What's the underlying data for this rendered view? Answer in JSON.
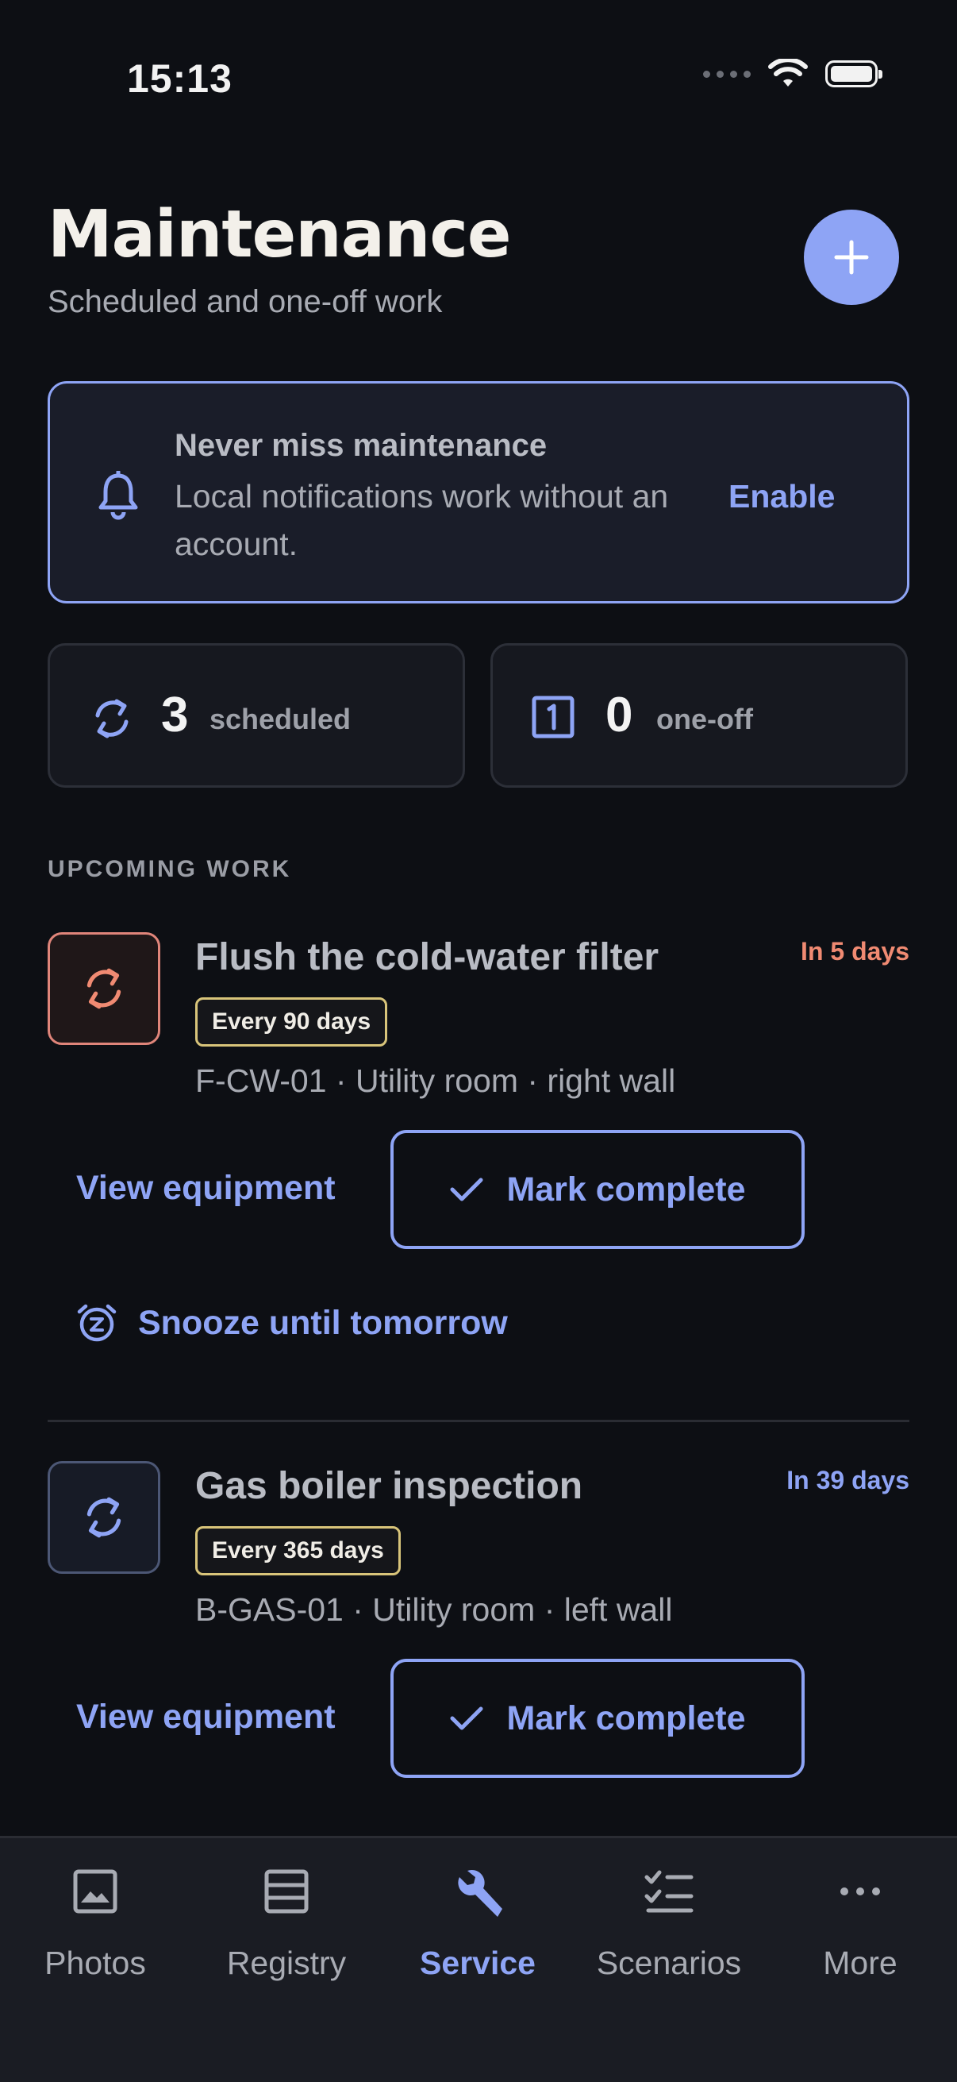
{
  "status_bar": {
    "time": "15:13"
  },
  "header": {
    "title": "Maintenance",
    "subtitle": "Scheduled and one-off work",
    "add_icon": "plus-icon"
  },
  "banner": {
    "title": "Never miss maintenance",
    "body": "Local notifications work without an account.",
    "action": "Enable",
    "icon": "bell-icon"
  },
  "stats": {
    "scheduled": {
      "count": "3",
      "label": "scheduled",
      "icon": "repeat-icon"
    },
    "one_off": {
      "count": "0",
      "label": "one-off",
      "icon": "one-box-icon"
    }
  },
  "section_label": "UPCOMING WORK",
  "tasks": [
    {
      "title": "Flush the cold-water filter",
      "due": "In 5 days",
      "due_color": "#f08a72",
      "frequency": "Every 90 days",
      "location": "F-CW-01 · Utility room · right wall",
      "view_label": "View equipment",
      "complete_label": "Mark complete",
      "snooze_label": "Snooze until tomorrow"
    },
    {
      "title": "Gas boiler inspection",
      "due": "In 39 days",
      "due_color": "#8ea4f5",
      "frequency": "Every 365 days",
      "location": "B-GAS-01 · Utility room · left wall",
      "view_label": "View equipment",
      "complete_label": "Mark complete"
    }
  ],
  "nav": {
    "items": [
      {
        "label": "Photos",
        "icon": "image-icon"
      },
      {
        "label": "Registry",
        "icon": "list-box-icon"
      },
      {
        "label": "Service",
        "icon": "wrench-icon",
        "active": true
      },
      {
        "label": "Scenarios",
        "icon": "checklist-icon"
      },
      {
        "label": "More",
        "icon": "more-icon"
      }
    ]
  },
  "colors": {
    "accent": "#8ea4f5",
    "warning": "#f08a72",
    "badge_border": "#d8c47a",
    "background": "#0d0f14"
  }
}
